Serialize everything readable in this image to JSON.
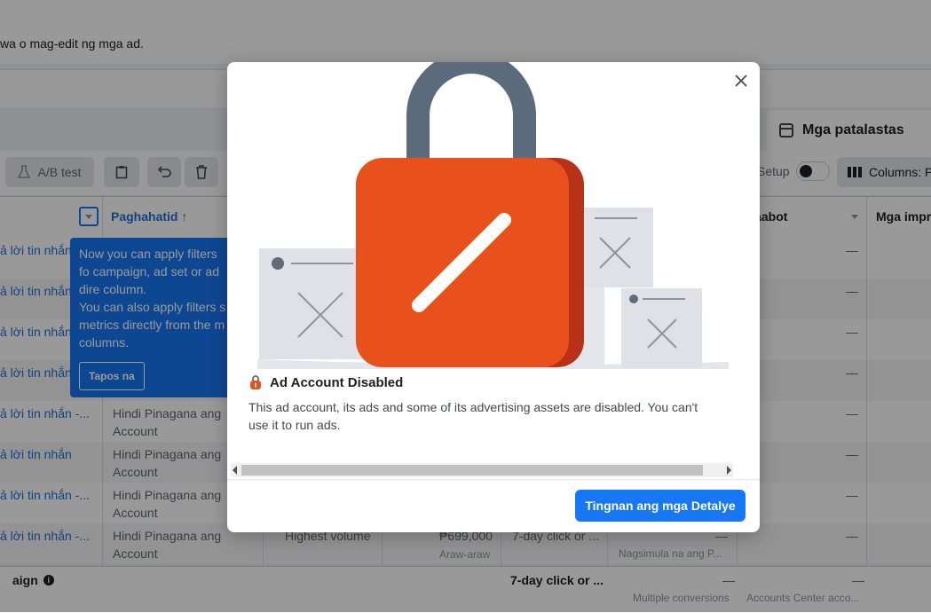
{
  "page": {
    "subtitle": "wa o mag-edit ng mga ad.",
    "ads_tab": "Mga patalastas"
  },
  "toolbar": {
    "ab_test": "A/B test",
    "setup": "Setup",
    "columns": "Columns: P"
  },
  "table": {
    "headers": {
      "delivery": "Paghahatid",
      "reach": "Naabot",
      "impressions": "Mga impre"
    },
    "rows": [
      {
        "name": "ả lời tin nhắn"
      },
      {
        "name": "ả lời tin nhắn"
      },
      {
        "name": "ả lời tin nhắn"
      },
      {
        "name": "ả lời tin nhắn"
      },
      {
        "name": "ả lời tin nhắn -...",
        "status": "Hindi Pinagana ang Account"
      },
      {
        "name": "ả lời tin nhắn",
        "status": "Hindi Pinagana ang Account"
      },
      {
        "name": "ả lời tin nhắn -...",
        "status": "Hindi Pinagana ang Account"
      },
      {
        "name": "ả lời tin nhắn -...",
        "status": "Hindi Pinagana ang Account",
        "bid": "Highest volume",
        "budget": "₱699,000",
        "budget_period": "Araw-araw",
        "attribution": "7-day click or ...",
        "reach_note": "Nagsimula na ang P..."
      }
    ],
    "dash": "—",
    "footer": {
      "label": "aign",
      "attribution": "7-day click or ...",
      "results_note": "Multiple conversions",
      "reach_note": "Accounts Center acco..."
    }
  },
  "tooltip": {
    "line1": "Now you can apply filters fo campaign, ad set or ad dire column.",
    "line2": "You can also apply filters s metrics directly from the m columns.",
    "done": "Tapos na"
  },
  "modal": {
    "title": "Ad Account Disabled",
    "body": "This ad account, its ads and some of its advertising assets are disabled. You can't use it to run ads.",
    "primary_button": "Tingnan ang mga Detalye",
    "colors": {
      "lock_body": "#e8501c",
      "lock_shackle": "#5b6b7c",
      "primary": "#1877f2"
    }
  }
}
